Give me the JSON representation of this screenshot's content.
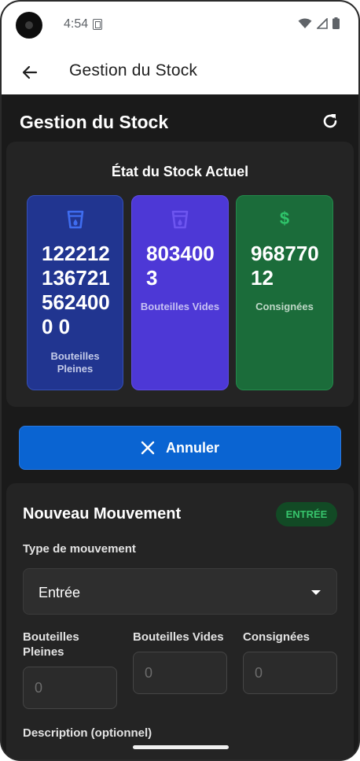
{
  "status_bar": {
    "time": "4:54"
  },
  "app_bar": {
    "title": "Gestion du Stock"
  },
  "page": {
    "title": "Gestion du Stock"
  },
  "stock": {
    "title": "État du Stock Actuel",
    "tiles": [
      {
        "value": "1222121367215624000 0",
        "label": "Bouteilles Pleines",
        "icon": "bottle-icon",
        "color": "#213590"
      },
      {
        "value": "8034003",
        "label": "Bouteilles Vides",
        "icon": "bottle-icon",
        "color": "#4d38d6"
      },
      {
        "value": "96877012",
        "label": "Consignées",
        "icon": "dollar-icon",
        "color": "#1b6c3a"
      }
    ]
  },
  "cancel_button": {
    "label": "Annuler",
    "color": "#0a64d2"
  },
  "movement": {
    "title": "Nouveau Mouvement",
    "badge": "ENTRÉE",
    "type_label": "Type de mouvement",
    "type_value": "Entrée",
    "full_label": "Bouteilles Pleines",
    "empty_label": "Bouteilles Vides",
    "deposit_label": "Consignées",
    "full_placeholder": "0",
    "empty_placeholder": "0",
    "deposit_placeholder": "0",
    "description_label": "Description (optionnel)"
  }
}
